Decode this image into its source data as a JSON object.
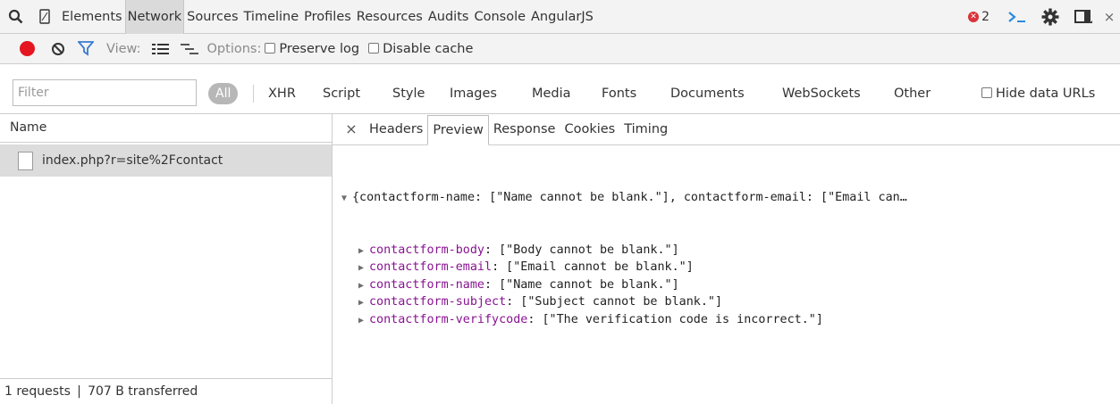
{
  "tabbar": {
    "tabs": [
      "Elements",
      "Network",
      "Sources",
      "Timeline",
      "Profiles",
      "Resources",
      "Audits",
      "Console",
      "AngularJS"
    ],
    "selected": "Network",
    "error_count": "2",
    "close_label": "×"
  },
  "toolbar": {
    "view_label": "View:",
    "options_label": "Options:",
    "preserve_log_label": "Preserve log",
    "disable_cache_label": "Disable cache"
  },
  "filter": {
    "placeholder": "Filter",
    "all_label": "All",
    "types": [
      "XHR",
      "Script",
      "Style",
      "Images",
      "Media",
      "Fonts",
      "Documents",
      "WebSockets",
      "Other"
    ],
    "hide_data_urls_label": "Hide data URLs"
  },
  "requests": {
    "column_header": "Name",
    "items": [
      {
        "name": "index.php?r=site%2Fcontact"
      }
    ],
    "status": "1 requests  |  707 B transferred"
  },
  "detail": {
    "close_label": "×",
    "tabs": [
      "Headers",
      "Preview",
      "Response",
      "Cookies",
      "Timing"
    ],
    "selected": "Preview",
    "summary": "{contactform-name: [\"Name cannot be blank.\"], contactform-email: [\"Email can…",
    "props": [
      {
        "key": "contactform-body",
        "value": ": [\"Body cannot be blank.\"]"
      },
      {
        "key": "contactform-email",
        "value": ": [\"Email cannot be blank.\"]"
      },
      {
        "key": "contactform-name",
        "value": ": [\"Name cannot be blank.\"]"
      },
      {
        "key": "contactform-subject",
        "value": ": [\"Subject cannot be blank.\"]"
      },
      {
        "key": "contactform-verifycode",
        "value": ": [\"The verification code is incorrect.\"]"
      }
    ]
  },
  "colors": {
    "record": "#e5161f",
    "filter_icon": "#3a7bd5",
    "json_key": "#881391",
    "error_badge": "#d8343a"
  },
  "icons": [
    "search-icon",
    "device-mode-icon",
    "record-icon",
    "clear-icon",
    "filter-icon",
    "list-view-icon",
    "waterfall-view-icon",
    "console-drawer-icon",
    "settings-gear-icon",
    "dock-side-icon",
    "file-icon"
  ]
}
